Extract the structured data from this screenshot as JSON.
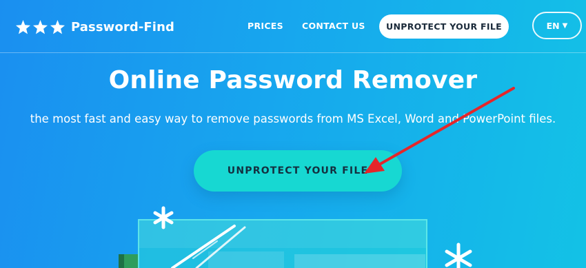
{
  "header": {
    "logo_text": "Password-Find",
    "logo_icon": "three-stars-icon",
    "nav": {
      "prices": "PRICES",
      "contact": "CONTACT US",
      "cta": "UNPROTECT YOUR FILE"
    },
    "language": {
      "selected": "EN"
    }
  },
  "hero": {
    "title": "Online Password Remover",
    "subtitle": "the most fast and easy way to remove passwords from MS Excel, Word and PowerPoint files.",
    "cta": "UNPROTECT YOUR FILE"
  },
  "annotation": {
    "arrow_color": "#e5262a"
  },
  "colors": {
    "background_start": "#1a8ff0",
    "background_end": "#13c2e6",
    "cta_primary": "#17d8d2",
    "cta_secondary": "#ffffff"
  }
}
